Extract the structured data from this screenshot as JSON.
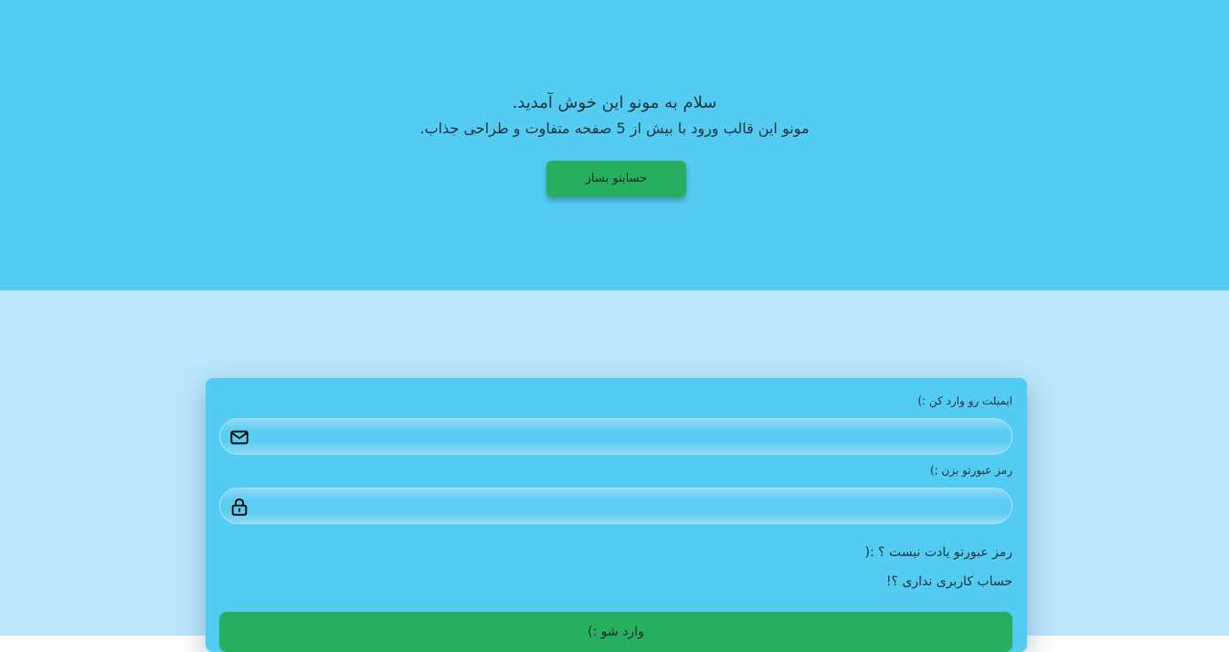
{
  "hero": {
    "title": "سلام به مونو این خوش آمدید.",
    "subtitle": "مونو این قالب ورود با بیش از 5 صفحه متفاوت و طراحی جذاب.",
    "cta_label": "حسابتو بساز"
  },
  "login": {
    "email_label": "ایمیلت رو وارد کن :)",
    "email_value": "",
    "email_icon": "envelope-icon",
    "password_label": "رمز عبورتو بزن ;)",
    "password_value": "",
    "password_icon": "lock-icon",
    "forgot_link": "رمز عبورتو یادت نیست ؟ :(",
    "signup_link": "حساب کاربری نداری ؟!",
    "submit_label": "وارد شو :)"
  },
  "colors": {
    "hero_bg": "#54cbf1",
    "page_bg": "#bbe7fc",
    "card_bg": "#54cbf1",
    "accent_green": "#27ae60"
  }
}
